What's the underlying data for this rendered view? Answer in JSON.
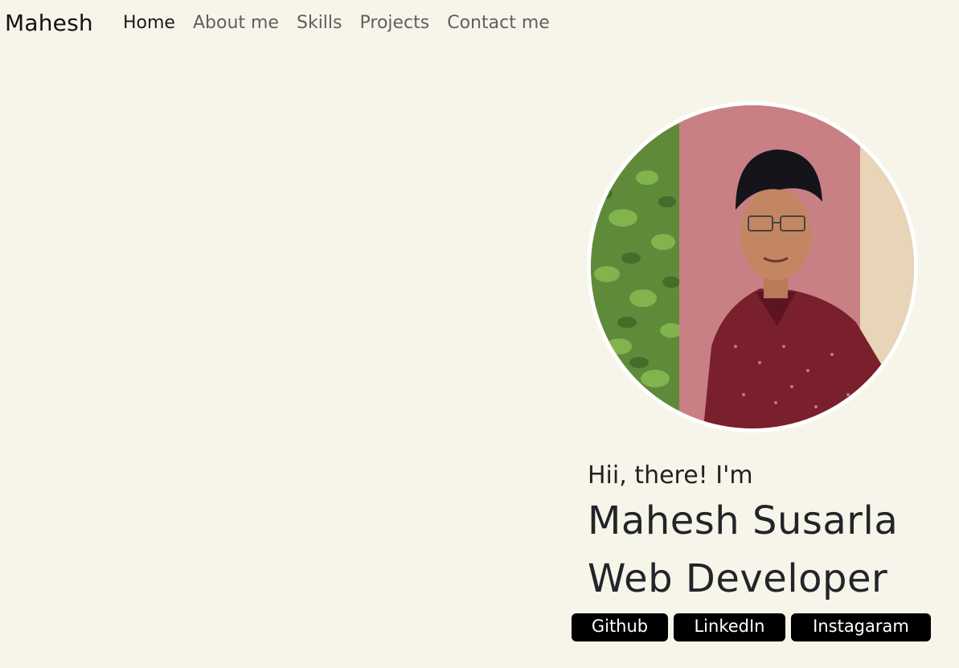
{
  "navbar": {
    "brand": "Mahesh",
    "items": [
      {
        "label": "Home",
        "active": true
      },
      {
        "label": "About me",
        "active": false
      },
      {
        "label": "Skills",
        "active": false
      },
      {
        "label": "Projects",
        "active": false
      },
      {
        "label": "Contact me",
        "active": false
      }
    ]
  },
  "hero": {
    "greeting": "Hii, there! I'm",
    "name": "Mahesh Susarla",
    "role": "Web Developer",
    "links": [
      {
        "label": "Github"
      },
      {
        "label": "LinkedIn"
      },
      {
        "label": "Instagaram"
      }
    ]
  },
  "colors": {
    "background": "#f7f5e9",
    "button_bg": "#000000",
    "button_text": "#ffffff",
    "nav_active": "#1a1a1a",
    "nav_inactive": "#5f5f5f"
  }
}
